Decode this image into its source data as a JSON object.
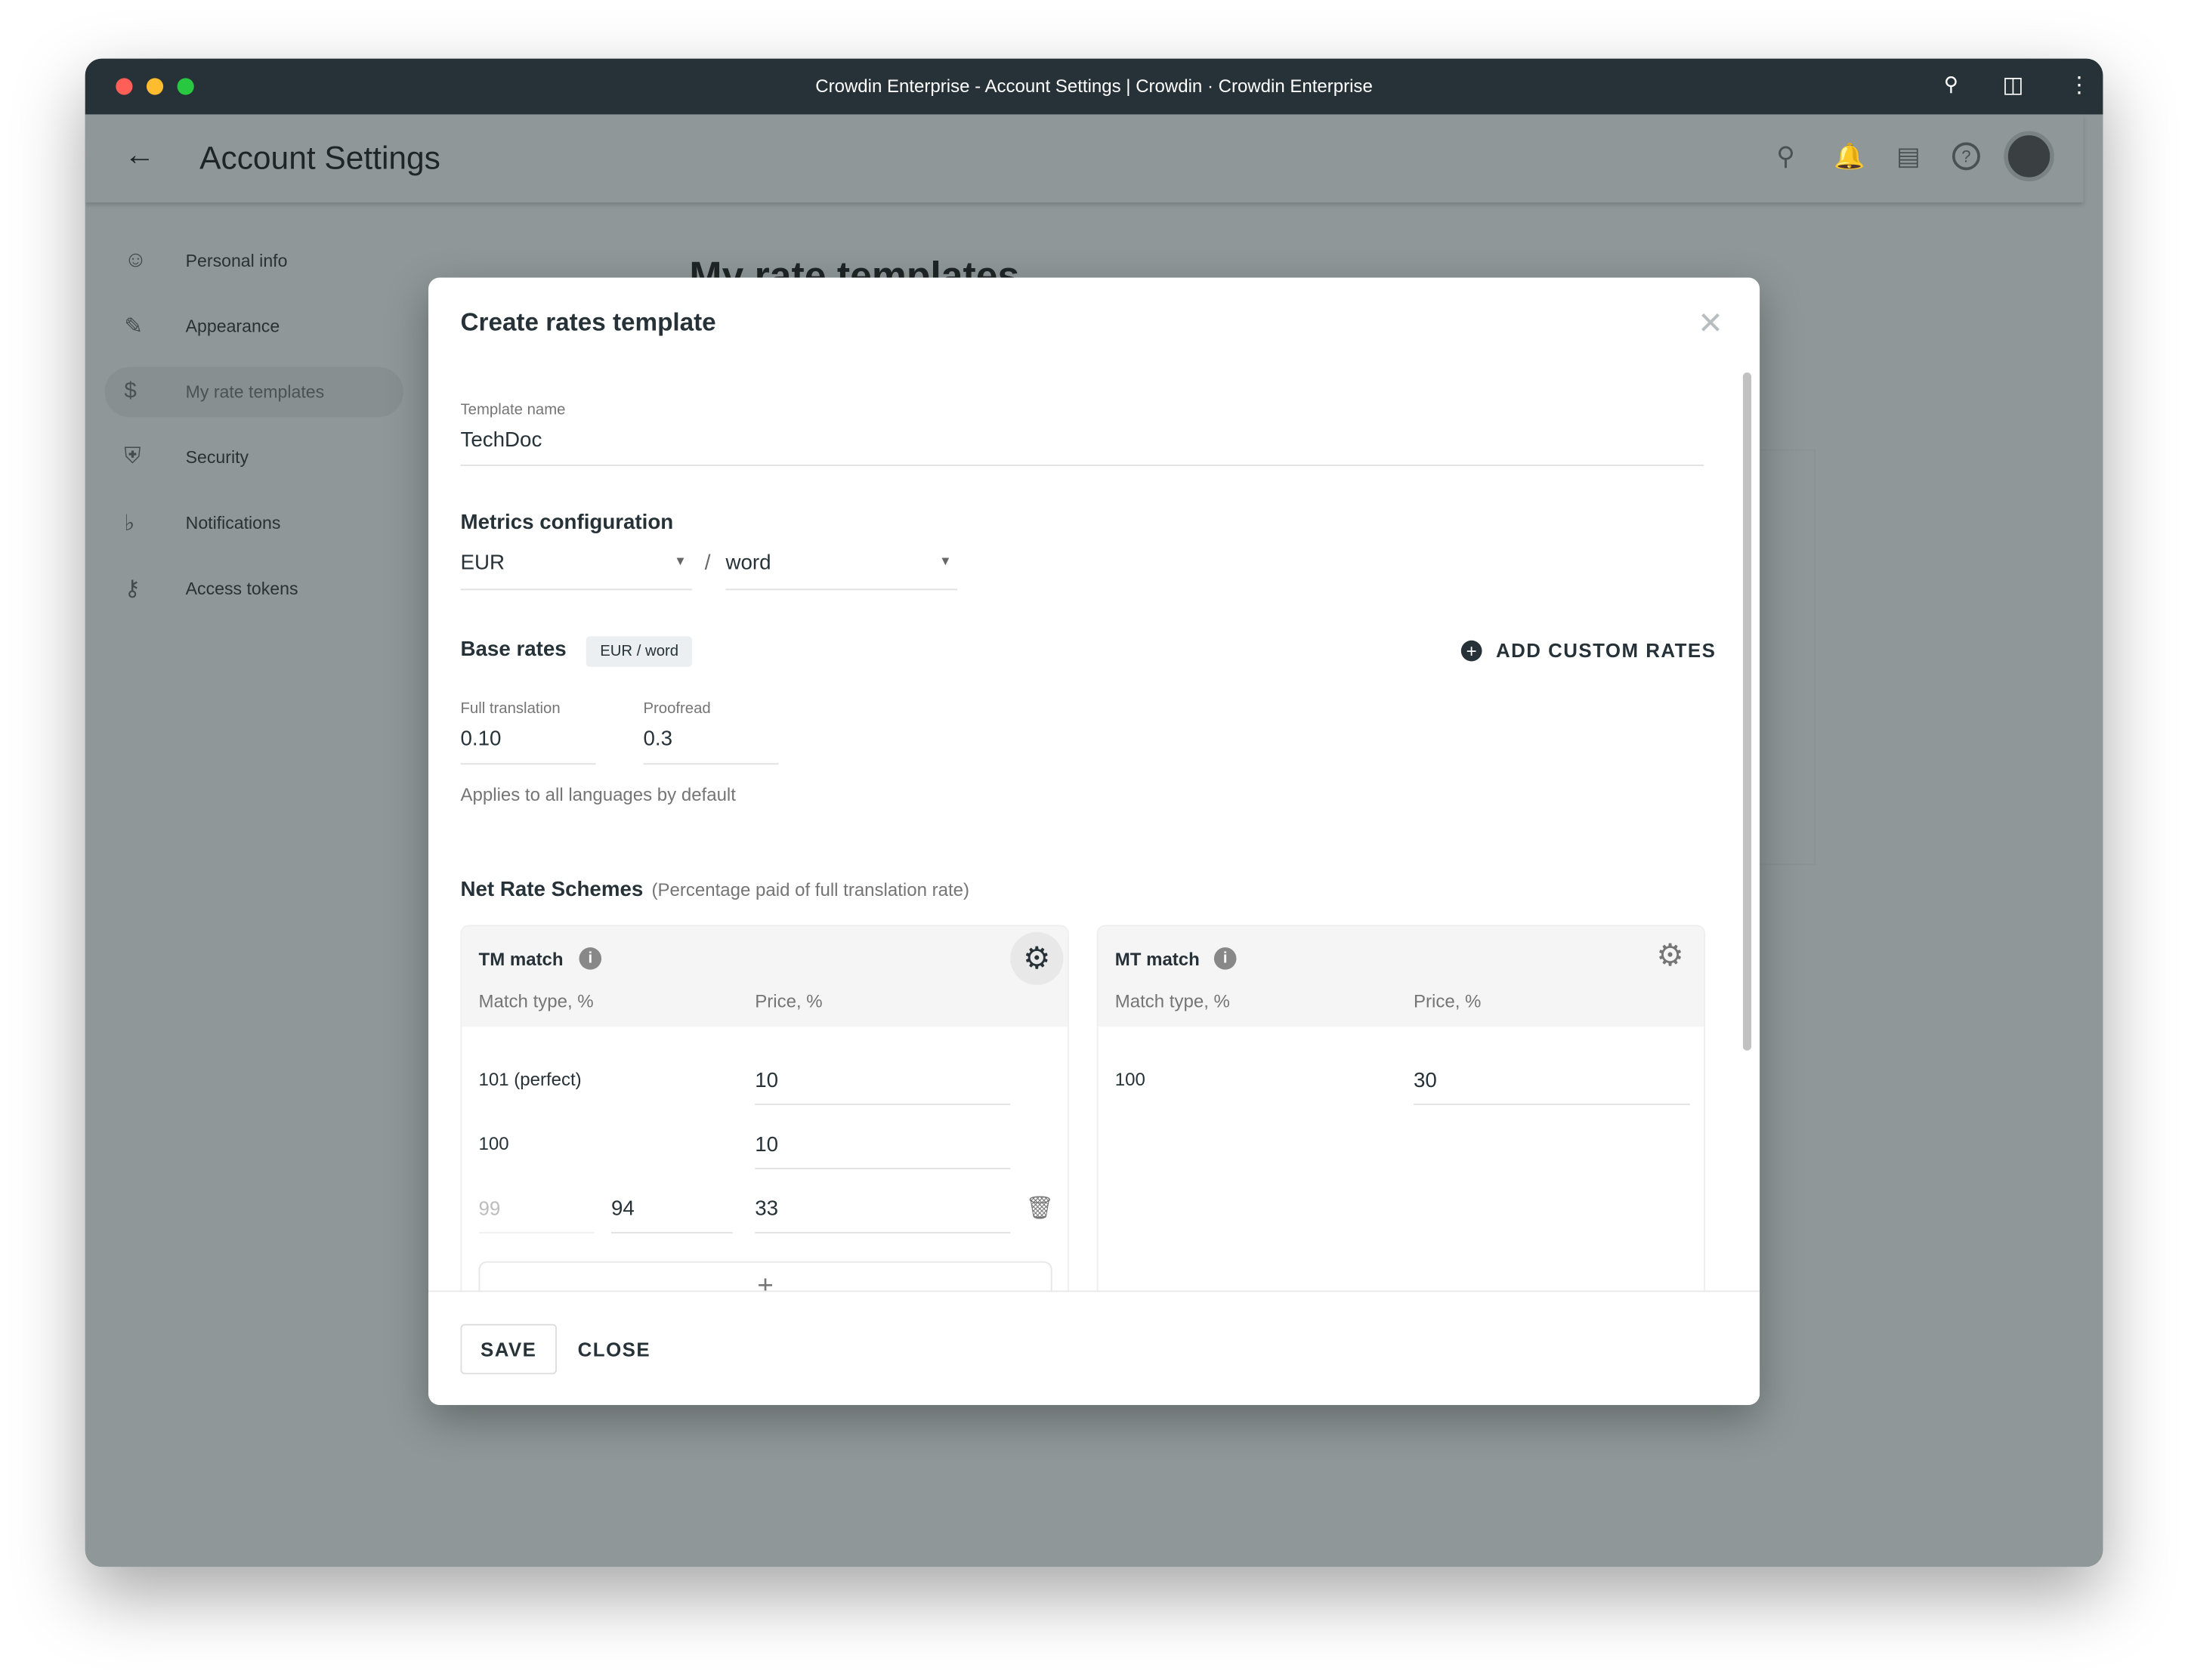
{
  "window": {
    "title": "Crowdin Enterprise - Account Settings | Crowdin · Crowdin Enterprise",
    "traffic_colors": [
      "#ff5f57",
      "#febc2e",
      "#28c840"
    ]
  },
  "header": {
    "title": "Account Settings",
    "icons": [
      "search-icon",
      "bell-icon",
      "chat-icon",
      "help-icon",
      "avatar"
    ]
  },
  "sidebar": {
    "items": [
      {
        "label": "Personal info",
        "icon": "account-circle-icon"
      },
      {
        "label": "Appearance",
        "icon": "brush-icon"
      },
      {
        "label": "My rate templates",
        "icon": "dollar-icon",
        "active": true
      },
      {
        "label": "Security",
        "icon": "shield-icon"
      },
      {
        "label": "Notifications",
        "icon": "bell-icon"
      },
      {
        "label": "Access tokens",
        "icon": "key-icon"
      }
    ]
  },
  "background": {
    "page_title": "My rate templates"
  },
  "modal": {
    "title": "Create rates template",
    "template_name_label": "Template name",
    "template_name": "TechDoc",
    "metrics_title": "Metrics configuration",
    "currency": "EUR",
    "separator": "/",
    "unit": "word",
    "base_rates_title": "Base rates",
    "base_rates_chip": "EUR / word",
    "add_custom_rates": "ADD CUSTOM RATES",
    "full_translation_label": "Full translation",
    "full_translation": "0.10",
    "proofread_label": "Proofread",
    "proofread": "0.3",
    "applies_note": "Applies to all languages by default",
    "net_title": "Net Rate Schemes",
    "net_subtitle": "(Percentage paid of full translation rate)",
    "tm": {
      "title": "TM match",
      "col1": "Match type, %",
      "col2": "Price, %",
      "rows": [
        {
          "match": "101 (perfect)",
          "price": "10"
        },
        {
          "match": "100",
          "price": "10"
        }
      ],
      "range": {
        "from": "99",
        "to": "94",
        "price": "33"
      },
      "add": "+"
    },
    "mt": {
      "title": "MT match",
      "col1": "Match type, %",
      "col2": "Price, %",
      "rows": [
        {
          "match": "100",
          "price": "30"
        }
      ]
    },
    "save": "SAVE",
    "close": "CLOSE"
  }
}
